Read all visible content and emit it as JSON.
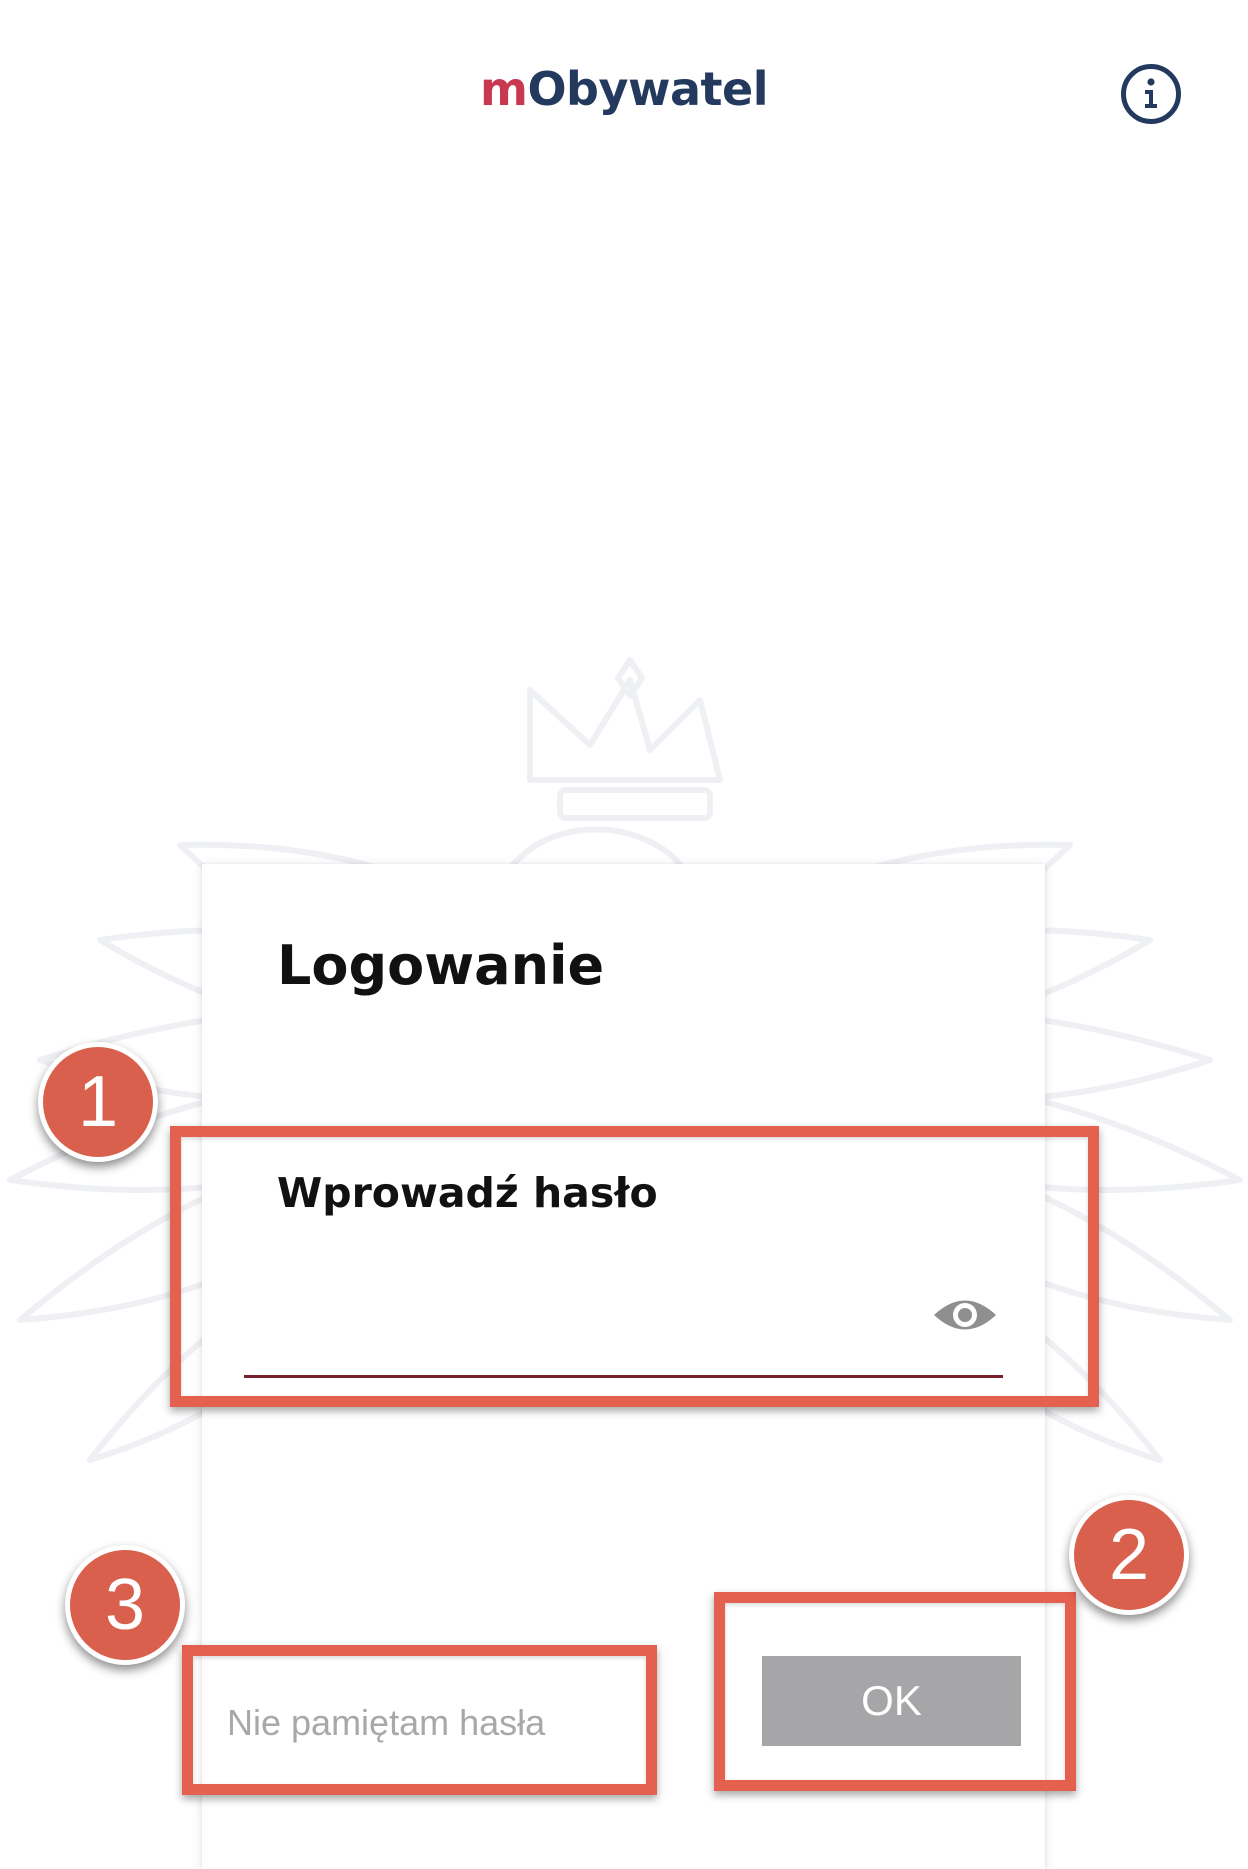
{
  "header": {
    "app_name_prefix": "m",
    "app_name_rest": "Obywatel",
    "info_icon": "info-icon"
  },
  "login_dialog": {
    "title": "Logowanie",
    "password_label": "Wprowadź hasło",
    "password_value": "",
    "visibility_icon": "eye-icon",
    "forgot_password": "Nie pamiętam hasła",
    "ok_label": "OK"
  },
  "annotations": {
    "callout_1": "1",
    "callout_2": "2",
    "callout_3": "3"
  },
  "colors": {
    "brand_red": "#c8394f",
    "brand_navy": "#233a5e",
    "underline": "#7c1f2c",
    "ok_button": "#a6a6a8",
    "callout": "#e4604f"
  }
}
